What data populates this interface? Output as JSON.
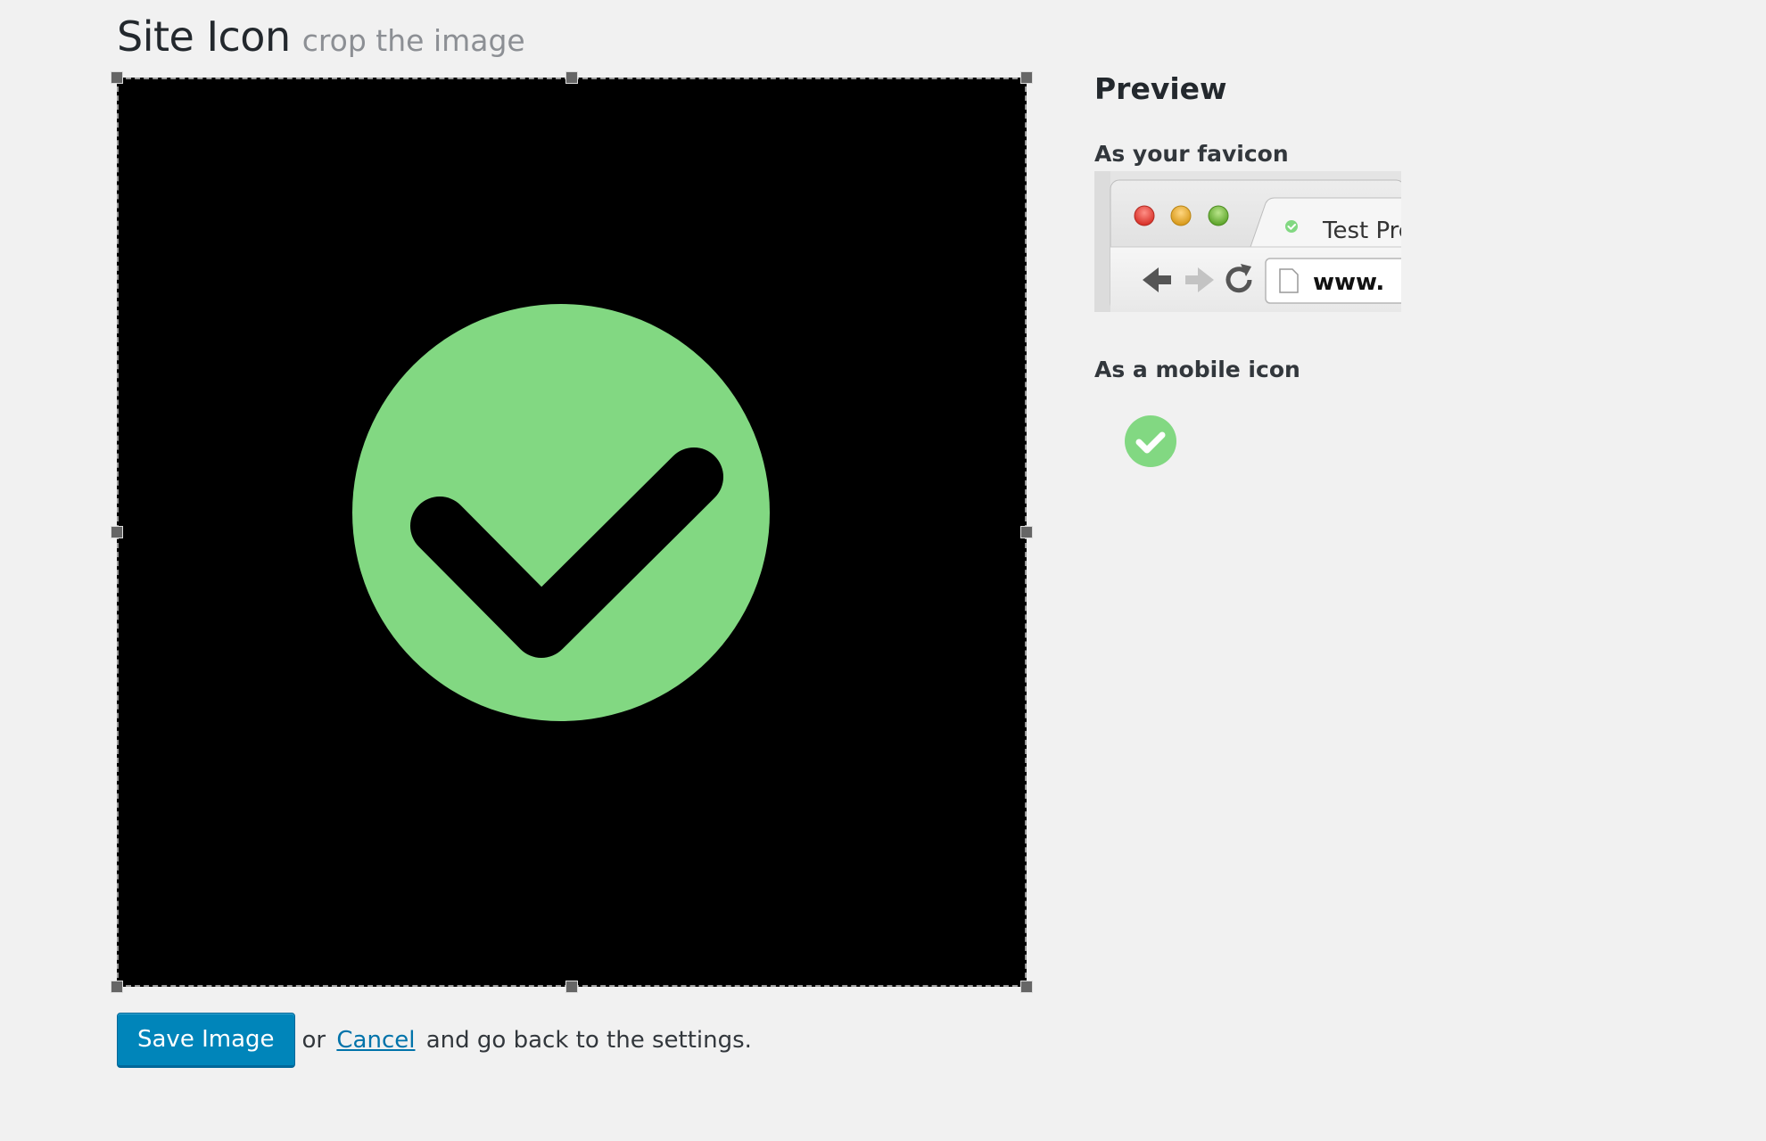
{
  "header": {
    "title": "Site Icon",
    "subtitle": "crop the image"
  },
  "crop_image": {
    "description": "green-circle-checkmark",
    "background_color": "#000000",
    "circle_color": "#82d882",
    "check_color": "#000000"
  },
  "actions": {
    "save_label": "Save Image",
    "or_text": "or",
    "cancel_label": "Cancel",
    "suffix_text": "and go back to the settings."
  },
  "preview": {
    "heading": "Preview",
    "favicon_label": "As your favicon",
    "mobile_label": "As a mobile icon",
    "browser": {
      "tab_title": "Test Pre",
      "url_text": "www."
    }
  },
  "colors": {
    "accent": "#0085ba",
    "link": "#0073aa",
    "icon_green": "#82d882"
  }
}
